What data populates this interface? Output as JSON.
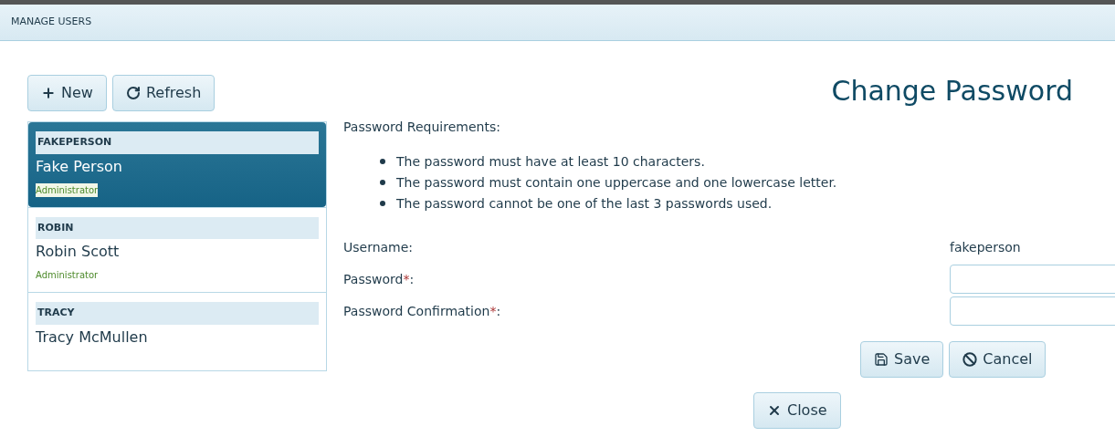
{
  "window": {
    "title": "MANAGE USERS"
  },
  "toolbar": {
    "buttons": [
      {
        "kind": "new",
        "label": "New"
      },
      {
        "kind": "refresh",
        "label": "Refresh"
      }
    ]
  },
  "users": [
    {
      "username": "FAKEPERSON",
      "name": "Fake Person",
      "role": "Administrator",
      "selected": true
    },
    {
      "username": "ROBIN",
      "name": "Robin Scott",
      "role": "Administrator",
      "selected": false
    },
    {
      "username": "TRACY",
      "name": "Tracy McMullen",
      "selected": false
    }
  ],
  "form": {
    "title": "Change Password",
    "requirements_label": "Password Requirements:",
    "requirements": [
      "The password must have at least 10 characters.",
      "The password must contain one uppercase and one lowercase letter.",
      "The password cannot be one of the last 3 passwords used."
    ],
    "fields": [
      {
        "kind": "text",
        "label": "Username:",
        "value": "fakeperson"
      },
      {
        "kind": "input",
        "label": "Password",
        "required_mark": "*",
        "label_end": ":"
      },
      {
        "kind": "input",
        "label": "Password Confirmation",
        "required_mark": "*",
        "label_end": ":"
      }
    ],
    "buttons": [
      {
        "kind": "save",
        "label": "Save"
      },
      {
        "kind": "cancel",
        "label": "Cancel"
      }
    ]
  },
  "close_button": {
    "label": "Close"
  }
}
